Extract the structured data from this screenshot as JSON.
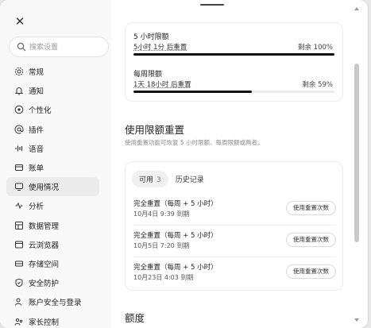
{
  "sidebar": {
    "search_placeholder": "搜索设置",
    "items": [
      {
        "label": "常规",
        "icon": "gear-icon"
      },
      {
        "label": "通知",
        "icon": "bell-icon"
      },
      {
        "label": "个性化",
        "icon": "personalize-icon"
      },
      {
        "label": "插件",
        "icon": "at-icon"
      },
      {
        "label": "语音",
        "icon": "voice-wave-icon"
      },
      {
        "label": "账单",
        "icon": "card-icon"
      },
      {
        "label": "使用情况",
        "icon": "usage-icon",
        "active": true
      },
      {
        "label": "分析",
        "icon": "analytics-icon"
      },
      {
        "label": "数据管理",
        "icon": "data-icon"
      },
      {
        "label": "云浏览器",
        "icon": "browser-icon"
      },
      {
        "label": "存储空间",
        "icon": "storage-icon"
      },
      {
        "label": "安全防护",
        "icon": "shield-icon"
      },
      {
        "label": "账户安全与登录",
        "icon": "account-lock-icon"
      },
      {
        "label": "家长控制",
        "icon": "parental-icon"
      }
    ]
  },
  "limits": [
    {
      "title": "5 小时限额",
      "reset": "5小时 1分 后重置",
      "remain": "剩余 100%",
      "fraction": 1.0
    },
    {
      "title": "每周限额",
      "reset": "1天 18小时 后重置",
      "remain": "剩余 59%",
      "fraction": 0.59
    }
  ],
  "reset_section": {
    "title": "使用限额重置",
    "description": "使用重置功能可恢复 5 小时限额、每周限额或两者。",
    "tabs": [
      {
        "label": "可用",
        "count": "3"
      },
      {
        "label": "历史记录"
      }
    ],
    "rows": [
      {
        "title": "完全重置（每周 + 5 小时）",
        "expiry": "10月4日 9:39 到期",
        "button": "使用重置次数"
      },
      {
        "title": "完全重置（每周 + 5 小时）",
        "expiry": "10月5日 7:20 到期",
        "button": "使用重置次数"
      },
      {
        "title": "完全重置（每周 + 5 小时）",
        "expiry": "10月23日 4:03 到期",
        "button": "使用重置次数"
      }
    ]
  },
  "quota_section": {
    "title": "额度"
  },
  "colors": {
    "accent": "#111111",
    "sidebar_bg": "#f9f9f9",
    "active_bg": "#ececec"
  }
}
